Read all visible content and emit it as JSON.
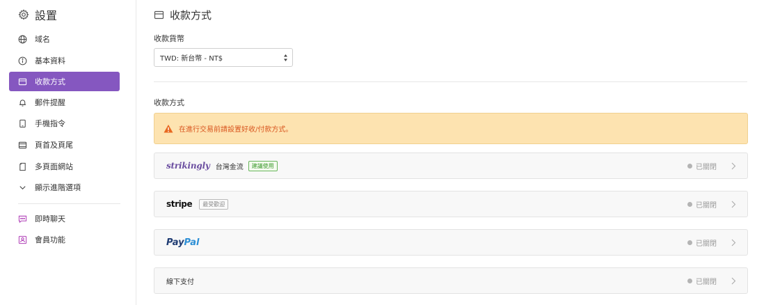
{
  "sidebar": {
    "title": "設置",
    "items": [
      {
        "label": "域名",
        "icon": "globe-icon"
      },
      {
        "label": "基本資料",
        "icon": "info-icon"
      },
      {
        "label": "收款方式",
        "icon": "credit-card-icon",
        "active": true
      },
      {
        "label": "郵件提醒",
        "icon": "bell-icon"
      },
      {
        "label": "手機指令",
        "icon": "phone-icon"
      },
      {
        "label": "頁首及頁尾",
        "icon": "header-footer-icon"
      },
      {
        "label": "多頁面網站",
        "icon": "pages-icon"
      },
      {
        "label": "顯示進階選項",
        "icon": "chevron-down-icon"
      },
      {
        "label": "即時聊天",
        "icon": "chat-icon"
      },
      {
        "label": "會員功能",
        "icon": "member-icon"
      }
    ]
  },
  "main": {
    "title": "收款方式",
    "currency": {
      "label": "收款貨幣",
      "value": "TWD: 新台幣 - NT$"
    },
    "methods_label": "收款方式",
    "alert": "在進行交易前請設置好收/付款方式。",
    "providers": [
      {
        "logo": "strikingly",
        "name": "台灣金流",
        "badge": "建議使用",
        "status": "已關閉"
      },
      {
        "logo": "stripe",
        "badge": "最受歡迎",
        "status": "已關閉"
      },
      {
        "logo_pay": "Pay",
        "logo_pal": "Pal",
        "status": "已關閉"
      },
      {
        "name": "線下支付",
        "status": "已關閉"
      }
    ]
  },
  "colors": {
    "accent": "#8557c0",
    "alert_bg": "#fde3b0",
    "alert_text": "#d9561f"
  }
}
